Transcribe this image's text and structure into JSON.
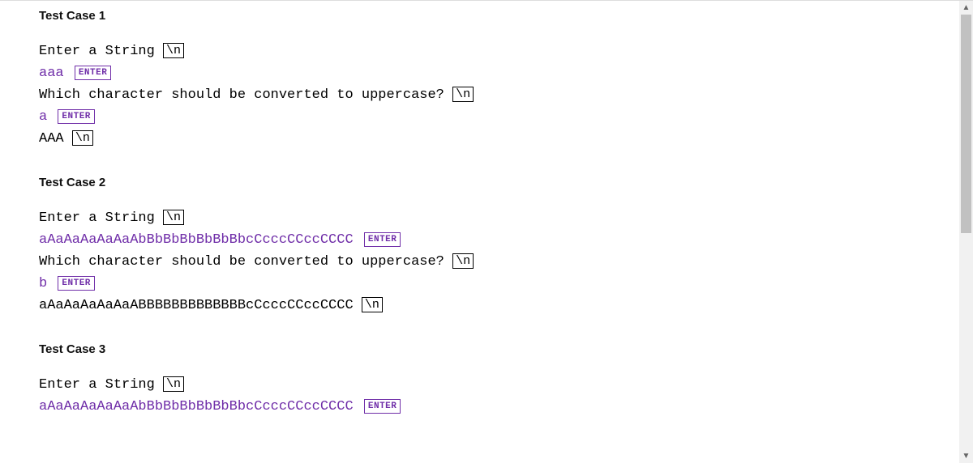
{
  "colors": {
    "purple": "#6f2da8",
    "black": "#000000"
  },
  "key_labels": {
    "newline": "\\n",
    "enter": "ENTER"
  },
  "test_cases": [
    {
      "title": "Test Case 1",
      "lines": [
        {
          "segments": [
            {
              "kind": "prompt",
              "text": "Enter a String"
            },
            {
              "kind": "space"
            },
            {
              "kind": "newline_key"
            }
          ]
        },
        {
          "segments": [
            {
              "kind": "input",
              "text": "aaa"
            },
            {
              "kind": "space"
            },
            {
              "kind": "enter_key"
            }
          ]
        },
        {
          "segments": [
            {
              "kind": "prompt",
              "text": "Which character should be converted to uppercase?"
            },
            {
              "kind": "space"
            },
            {
              "kind": "newline_key"
            }
          ]
        },
        {
          "segments": [
            {
              "kind": "input",
              "text": "a"
            },
            {
              "kind": "space"
            },
            {
              "kind": "enter_key"
            }
          ]
        },
        {
          "segments": [
            {
              "kind": "prompt",
              "text": "AAA"
            },
            {
              "kind": "space"
            },
            {
              "kind": "newline_key"
            }
          ]
        }
      ]
    },
    {
      "title": "Test Case 2",
      "lines": [
        {
          "segments": [
            {
              "kind": "prompt",
              "text": "Enter a String"
            },
            {
              "kind": "space"
            },
            {
              "kind": "newline_key"
            }
          ]
        },
        {
          "segments": [
            {
              "kind": "input",
              "text": "aAaAaAaAaAaAbBbBbBbBbBbBbcCcccCCccCCCC"
            },
            {
              "kind": "space"
            },
            {
              "kind": "enter_key"
            }
          ]
        },
        {
          "segments": [
            {
              "kind": "prompt",
              "text": "Which character should be converted to uppercase?"
            },
            {
              "kind": "space"
            },
            {
              "kind": "newline_key"
            }
          ]
        },
        {
          "segments": [
            {
              "kind": "input",
              "text": "b"
            },
            {
              "kind": "space"
            },
            {
              "kind": "enter_key"
            }
          ]
        },
        {
          "segments": [
            {
              "kind": "prompt",
              "text": "aAaAaAaAaAaABBBBBBBBBBBBBcCcccCCccCCCC"
            },
            {
              "kind": "space"
            },
            {
              "kind": "newline_key"
            }
          ]
        }
      ]
    },
    {
      "title": "Test Case 3",
      "lines": [
        {
          "segments": [
            {
              "kind": "prompt",
              "text": "Enter a String"
            },
            {
              "kind": "space"
            },
            {
              "kind": "newline_key"
            }
          ]
        },
        {
          "segments": [
            {
              "kind": "input",
              "text": "aAaAaAaAaAaAbBbBbBbBbBbBbcCcccCCccCCCC"
            },
            {
              "kind": "space"
            },
            {
              "kind": "enter_key"
            }
          ]
        }
      ]
    }
  ]
}
